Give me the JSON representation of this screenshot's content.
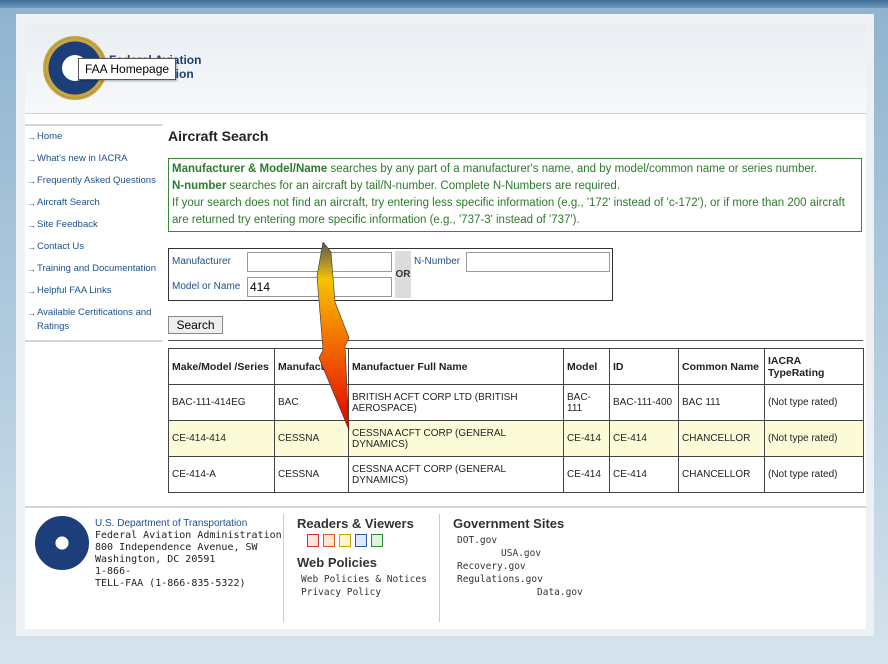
{
  "header": {
    "org_name_line1": "Federal Aviation",
    "org_name_line2": "Administration",
    "tooltip": "FAA Homepage"
  },
  "sidebar": {
    "items": [
      {
        "label": "Home"
      },
      {
        "label": "What's new in IACRA"
      },
      {
        "label": "Frequently Asked Questions"
      },
      {
        "label": "Aircraft Search"
      },
      {
        "label": "Site Feedback"
      },
      {
        "label": "Contact Us"
      },
      {
        "label": "Training and Documentation"
      },
      {
        "label": "Helpful FAA Links"
      },
      {
        "label": "Available Certifications and Ratings"
      }
    ]
  },
  "main": {
    "title": "Aircraft Search",
    "info": {
      "line1_bold": "Manufacturer & Model/Name",
      "line1_rest": " searches by any part of a manufacturer's name, and by model/common name or series number.",
      "line2_bold": "N-number",
      "line2_rest": " searches for an aircraft by tail/N-number. Complete N-Numbers are required.",
      "line3": "If your search does not find an aircraft, try entering less specific information (e.g., '172' instead of 'c-172'), or if more than 200 aircraft are returned try entering more specific information (e.g., '737-3' instead of '737')."
    },
    "form": {
      "manufacturer_label": "Manufacturer",
      "manufacturer_value": "",
      "model_label": "Model or Name",
      "model_value": "414",
      "or_label": "OR",
      "nnumber_label": "N-Number",
      "nnumber_value": "",
      "search_button": "Search"
    },
    "table": {
      "headers": [
        "Make/Model /Series",
        "Manufactuer",
        "Manufactuer Full Name",
        "Model",
        "ID",
        "Common Name",
        "IACRA TypeRating"
      ],
      "rows": [
        [
          "BAC-111-414EG",
          "BAC",
          "BRITISH ACFT CORP LTD (BRITISH AEROSPACE)",
          "BAC-111",
          "BAC-111-400",
          "BAC 111",
          "(Not type rated)"
        ],
        [
          "CE-414-414",
          "CESSNA",
          "CESSNA ACFT CORP (GENERAL DYNAMICS)",
          "CE-414",
          "CE-414",
          "CHANCELLOR",
          "(Not type rated)"
        ],
        [
          "CE-414-A",
          "CESSNA",
          "CESSNA ACFT CORP (GENERAL DYNAMICS)",
          "CE-414",
          "CE-414",
          "CHANCELLOR",
          "(Not type rated)"
        ]
      ]
    }
  },
  "footer": {
    "address": {
      "dept": "U.S. Department of Transportation",
      "line1": "Federal Aviation Administration",
      "line2": "800 Independence Avenue, SW",
      "line3": "Washington, DC 20591",
      "line4": "1-866-",
      "line5": "TELL-FAA (1-866-835-5322)"
    },
    "readers_title": "Readers & Viewers",
    "web_policies_title": "Web Policies",
    "web_policies_links": [
      "Web Policies & Notices",
      "Privacy Policy"
    ],
    "gov_sites_title": "Government Sites",
    "gov_sites_links": [
      "DOT.gov",
      "USA.gov",
      "Recovery.gov",
      "Regulations.gov",
      "Data.gov"
    ]
  },
  "colors": {
    "link_blue": "#1d4f8a",
    "info_green": "#2d7a2d",
    "row_highlight": "#fbfbd8"
  }
}
